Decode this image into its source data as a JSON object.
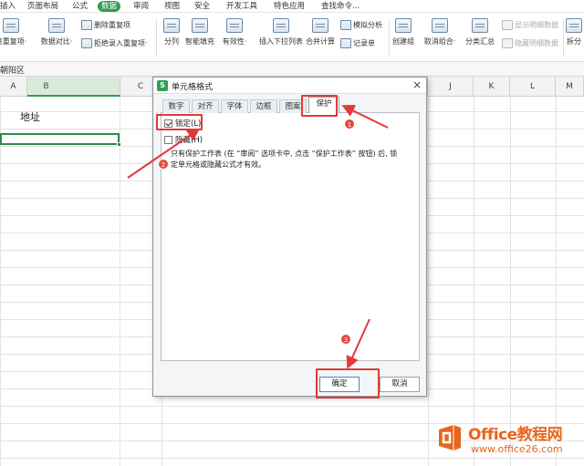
{
  "menu": {
    "items": [
      {
        "label": "插入",
        "active": false
      },
      {
        "label": "页面布局",
        "active": false
      },
      {
        "label": "公式",
        "active": false
      },
      {
        "label": "数据",
        "active": true
      },
      {
        "label": "审阅",
        "active": false
      },
      {
        "label": "视图",
        "active": false
      },
      {
        "label": "安全",
        "active": false
      },
      {
        "label": "开发工具",
        "active": false
      },
      {
        "label": "特色应用",
        "active": false
      },
      {
        "label": "查找命令...",
        "active": false
      }
    ]
  },
  "ribbon": {
    "highlight_dup": "亮重复项·",
    "data_compare": "数据对比·",
    "delete_dup": "删除重复项",
    "reject_dup": "拒绝录入重复项·",
    "split": "分列",
    "smart_fill": "智能填充",
    "validity": "有效性·",
    "insert_dropdown": "插入下拉列表",
    "merge_calc": "合并计算",
    "simulate": "模拟分析",
    "record": "记录单",
    "create_group": "创建组",
    "ungroup": "取消组合·",
    "subtotal": "分类汇总",
    "show_detail": "显示明细数据",
    "hide_detail": "隐藏明细数据",
    "split_table": "拆分"
  },
  "name_box": "朝阳区",
  "columns": {
    "a": "A",
    "b": "B",
    "c": "C",
    "j": "J",
    "k": "K",
    "l": "L",
    "m": "M"
  },
  "cells": {
    "b1": "地址"
  },
  "dialog": {
    "title": "单元格格式",
    "close": "×",
    "tabs": [
      "数字",
      "对齐",
      "字体",
      "边框",
      "图案",
      "保护"
    ],
    "active_tab": "保护",
    "locked": {
      "label": "锁定(L)",
      "checked": true
    },
    "hidden": {
      "label": "隐藏(H)",
      "checked": false
    },
    "note_line1": "只有保护工作表 (在 “审阅” 选项卡中, 点击 “保护工作表” 按钮) 后, 锁",
    "note_line2": "定单元格或隐藏公式才有效。",
    "ok": "确定",
    "cancel": "取消"
  },
  "annotations": {
    "badge1": "1",
    "badge2": "2",
    "badge3": "3",
    "color": "#e03a3a"
  },
  "watermark": {
    "title": "Office教程网",
    "url": "www.office26.com",
    "color": "#e8661c"
  }
}
